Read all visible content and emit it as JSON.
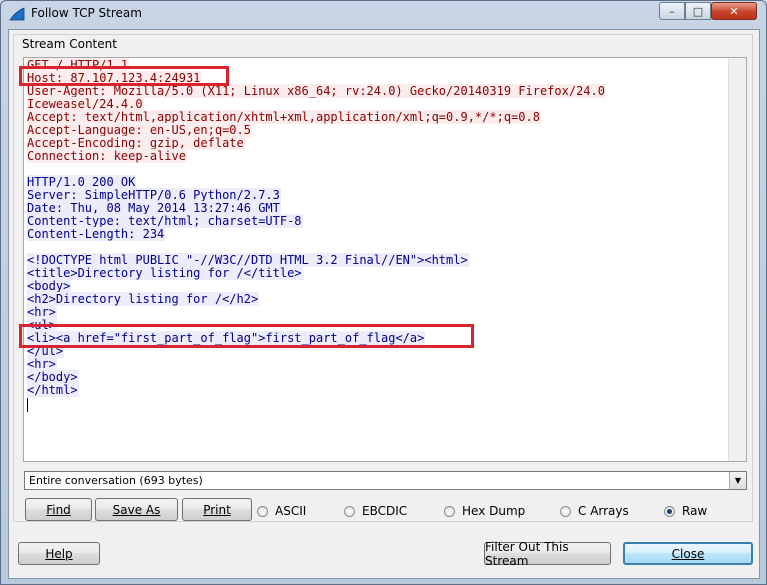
{
  "window": {
    "title": "Follow TCP Stream",
    "controls": {
      "minimize": "–",
      "maximize": "□",
      "close": "✕"
    }
  },
  "group_label": "Stream Content",
  "stream_lines": [
    {
      "dir": "req",
      "text": "GET / HTTP/1.1"
    },
    {
      "dir": "req",
      "text": "Host: 87.107.123.4:24931"
    },
    {
      "dir": "req",
      "text": "User-Agent: Mozilla/5.0 (X11; Linux x86_64; rv:24.0) Gecko/20140319 Firefox/24.0"
    },
    {
      "dir": "req",
      "text": "Iceweasel/24.4.0"
    },
    {
      "dir": "req",
      "text": "Accept: text/html,application/xhtml+xml,application/xml;q=0.9,*/*;q=0.8"
    },
    {
      "dir": "req",
      "text": "Accept-Language: en-US,en;q=0.5"
    },
    {
      "dir": "req",
      "text": "Accept-Encoding: gzip, deflate"
    },
    {
      "dir": "req",
      "text": "Connection: keep-alive"
    },
    {
      "dir": "blank",
      "text": ""
    },
    {
      "dir": "resp",
      "text": "HTTP/1.0 200 OK"
    },
    {
      "dir": "resp",
      "text": "Server: SimpleHTTP/0.6 Python/2.7.3"
    },
    {
      "dir": "resp",
      "text": "Date: Thu, 08 May 2014 13:27:46 GMT"
    },
    {
      "dir": "resp",
      "text": "Content-type: text/html; charset=UTF-8"
    },
    {
      "dir": "resp",
      "text": "Content-Length: 234"
    },
    {
      "dir": "blank",
      "text": ""
    },
    {
      "dir": "resp",
      "text": "<!DOCTYPE html PUBLIC \"-//W3C//DTD HTML 3.2 Final//EN\"><html>"
    },
    {
      "dir": "resp",
      "text": "<title>Directory listing for /</title>"
    },
    {
      "dir": "resp",
      "text": "<body>"
    },
    {
      "dir": "resp",
      "text": "<h2>Directory listing for /</h2>"
    },
    {
      "dir": "resp",
      "text": "<hr>"
    },
    {
      "dir": "resp",
      "text": "<ul>"
    },
    {
      "dir": "resp",
      "text": "<li><a href=\"first_part_of_flag\">first_part_of_flag</a>"
    },
    {
      "dir": "resp",
      "text": "</ul>"
    },
    {
      "dir": "resp",
      "text": "<hr>"
    },
    {
      "dir": "resp",
      "text": "</body>"
    },
    {
      "dir": "resp",
      "text": "</html>"
    }
  ],
  "conversation_select": "Entire conversation (693 bytes)",
  "buttons": {
    "find": "Find",
    "save_as": "Save As",
    "print": "Print",
    "help": "Help",
    "filter_out": "Filter Out This Stream",
    "close": "Close"
  },
  "formats": [
    {
      "label": "ASCII",
      "selected": false
    },
    {
      "label": "EBCDIC",
      "selected": false
    },
    {
      "label": "Hex Dump",
      "selected": false
    },
    {
      "label": "C Arrays",
      "selected": false
    },
    {
      "label": "Raw",
      "selected": true
    }
  ],
  "colors": {
    "request_text": "#8b0000",
    "request_bg": "#fbeded",
    "response_text": "#00008b",
    "response_bg": "#ececfb",
    "highlight_box": "#d9232f"
  }
}
